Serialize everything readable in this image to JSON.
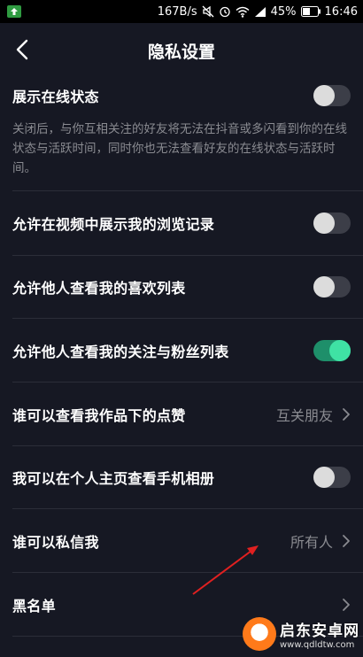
{
  "status_bar": {
    "speed": "167B/s",
    "battery": "45%",
    "time": "16:46"
  },
  "nav": {
    "title": "隐私设置"
  },
  "settings": {
    "online_status": {
      "label": "展示在线状态",
      "description": "关闭后，与你互相关注的好友将无法在抖音或多闪看到你的在线状态与活跃时间，同时你也无法查看好友的在线状态与活跃时间。",
      "enabled": false
    },
    "browse_history": {
      "label": "允许在视频中展示我的浏览记录",
      "enabled": false
    },
    "likes_list": {
      "label": "允许他人查看我的喜欢列表",
      "enabled": false
    },
    "follow_fans_list": {
      "label": "允许他人查看我的关注与粉丝列表",
      "enabled": true
    },
    "who_can_see_likes": {
      "label": "谁可以查看我作品下的点赞",
      "value": "互关朋友"
    },
    "phone_album": {
      "label": "我可以在个人主页查看手机相册",
      "enabled": false
    },
    "who_can_message": {
      "label": "谁可以私信我",
      "value": "所有人"
    },
    "blacklist": {
      "label": "黑名单"
    }
  },
  "watermark": {
    "title": "启东安卓网",
    "url": "www.qdldtw.com"
  },
  "colors": {
    "background": "#161823",
    "toggle_on": "#3fe2a4",
    "annotation_arrow": "#e02020"
  }
}
